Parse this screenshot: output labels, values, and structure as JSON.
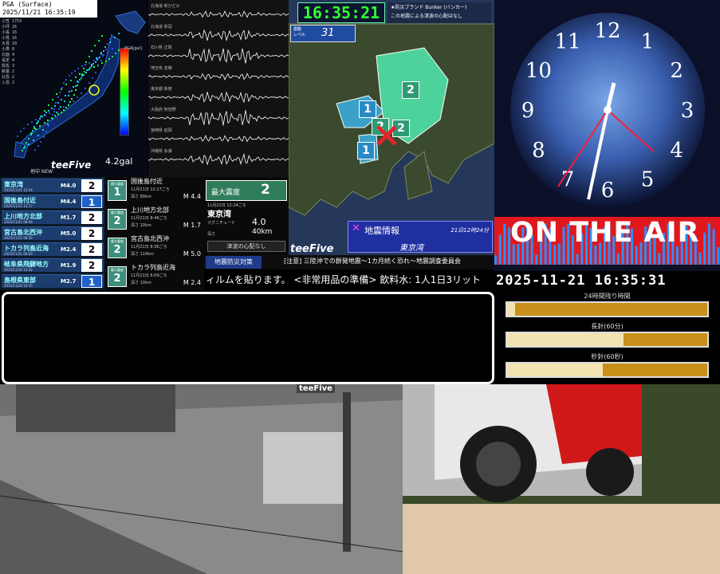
{
  "pga": {
    "header_line1": "PGA (Surface)",
    "header_line2": "2025/11/21 16:35:19",
    "scale_label": "PGA[gal]",
    "peak": "4.2gal",
    "brand": "teeFive",
    "tag": "地中 NEW",
    "stations": [
      "小笠 1753",
      "小坪 26",
      "小長 16",
      "小見 16",
      "大見 10",
      "小貫 8",
      "北面 4",
      "長定 4",
      "呉佐 3",
      "新富 2",
      "北島 2",
      "入島 2"
    ]
  },
  "waveforms": {
    "labels": [
      "北海道 新ひだか",
      "北海道 新冠",
      "石川県 正院",
      "埼玉県 岩槻",
      "東京都 新宿",
      "大阪府 阿倍野",
      "宮崎県 延岡",
      "沖縄県 糸満"
    ]
  },
  "quake_list": [
    {
      "name": "東京湾",
      "date": "2025/11/21 12:24",
      "mag": "M4.0",
      "int": "2",
      "hi": true
    },
    {
      "name": "国後島付近",
      "date": "2025/11/21 12:17",
      "mag": "M4.4",
      "int": "1",
      "hi": false
    },
    {
      "name": "上川地方北部",
      "date": "2025/11/21 08:46",
      "mag": "M1.7",
      "int": "2",
      "hi": true
    },
    {
      "name": "宮古島北西沖",
      "date": "2025/11/21 08:36",
      "mag": "M5.0",
      "int": "2",
      "hi": true
    },
    {
      "name": "トカラ列島近海",
      "date": "2025/11/21 06:09",
      "mag": "M2.4",
      "int": "2",
      "hi": true
    },
    {
      "name": "岐阜県飛騨地方",
      "date": "2025/11/20 12:42",
      "mag": "M1.9",
      "int": "2",
      "hi": true
    },
    {
      "name": "島根県東部",
      "date": "2025/11/20 10:35",
      "mag": "M2.7",
      "int": "1",
      "hi": false
    }
  ],
  "events": [
    {
      "cap": "最大震度",
      "int": "1",
      "place": "国後島付近",
      "time": "11月21日 12:17ごろ",
      "dep": "深さ  80km",
      "mag": "M 4.4"
    },
    {
      "cap": "最大震度",
      "int": "2",
      "place": "上川地方北部",
      "time": "11月21日 8:46ごろ",
      "dep": "深さ  10km",
      "mag": "M 1.7"
    },
    {
      "cap": "最大震度",
      "int": "2",
      "place": "宮古島北西沖",
      "time": "11月21日 8:36ごろ",
      "dep": "深さ 110km",
      "mag": "M 5.0"
    },
    {
      "cap": "最大震度",
      "int": "2",
      "place": "トカラ列島近海",
      "time": "11月21日 6:09ごろ",
      "dep": "深さ  10km",
      "mag": "M 2.4"
    }
  ],
  "summary": {
    "max_label": "最大震度",
    "max_value": "2",
    "time": "11月21日 12:24ごろ",
    "location": "東京湾",
    "mag_label": "マグニチュード",
    "mag_value": "4.0",
    "depth_label": "深さ",
    "depth_value": "40km",
    "note": "津波の心配なし"
  },
  "kanto": {
    "clock": "16:35:21",
    "title_line1": "★防災ブランド Bunker (バンカー)",
    "title_line2": "この地震による津波の心配はなし",
    "level_cap1": "震動",
    "level_cap2": "レベル",
    "level_value": "31",
    "info_title": "地震情報",
    "info_time": "21日12時24分",
    "info_location": "東京湾",
    "brand": "teeFive",
    "markers": [
      "2",
      "1",
      "2",
      "2",
      "1"
    ]
  },
  "ticker": {
    "tag": "地震防災対策",
    "message": "[注意] 三陸沖での群発地震〜1カ月続く恐れ〜地震調査委員会",
    "scroll": "ィルムを貼ります。 <非常用品の準備> 飲料水: 1人1日3リット"
  },
  "onair": {
    "text": "ON THE AIR",
    "datetime": "2025-11-21 16:35:31",
    "bars": [
      {
        "label": "24時間残り時間",
        "progress": 0.04
      },
      {
        "label": "長針(60分)",
        "progress": 0.58
      },
      {
        "label": "秒針(60秒)",
        "progress": 0.48
      }
    ],
    "clock_numbers": [
      "12",
      "1",
      "2",
      "3",
      "4",
      "5",
      "6",
      "7",
      "8",
      "9",
      "10",
      "11"
    ]
  },
  "camera": {
    "logo": "teeFive"
  }
}
